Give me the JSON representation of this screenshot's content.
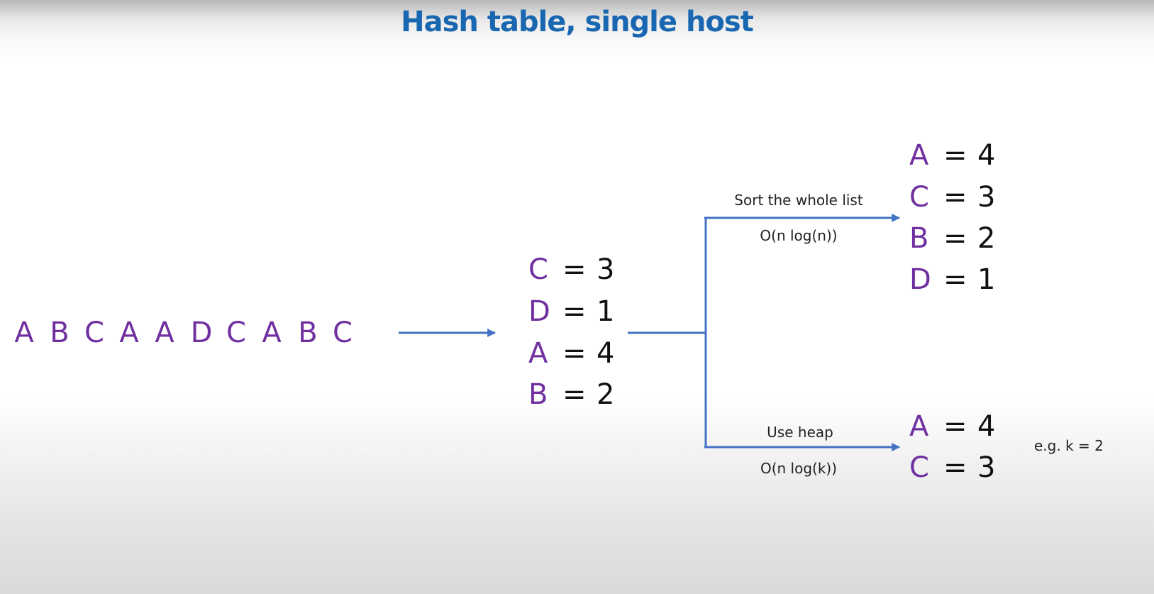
{
  "title": "Hash table, single host",
  "sequence": [
    "A",
    "B",
    "C",
    "A",
    "A",
    "D",
    "C",
    "A",
    "B",
    "C"
  ],
  "counts": [
    {
      "key": "C",
      "eq": "=",
      "value": "3"
    },
    {
      "key": "D",
      "eq": "=",
      "value": "1"
    },
    {
      "key": "A",
      "eq": "=",
      "value": "4"
    },
    {
      "key": "B",
      "eq": "=",
      "value": "2"
    }
  ],
  "sorted_branch": {
    "label": "Sort the whole list",
    "complexity": "O(n log(n))",
    "results": [
      {
        "key": "A",
        "eq": "=",
        "value": "4"
      },
      {
        "key": "C",
        "eq": "=",
        "value": "3"
      },
      {
        "key": "B",
        "eq": "=",
        "value": "2"
      },
      {
        "key": "D",
        "eq": "=",
        "value": "1"
      }
    ]
  },
  "heap_branch": {
    "label": "Use heap",
    "complexity": "O(n log(k))",
    "results": [
      {
        "key": "A",
        "eq": "=",
        "value": "4"
      },
      {
        "key": "C",
        "eq": "=",
        "value": "3"
      }
    ],
    "note": "e.g. k = 2"
  },
  "colors": {
    "title": "#1a67b1",
    "key": "#7030a0",
    "arrow": "#4472c4",
    "text": "#111111"
  }
}
